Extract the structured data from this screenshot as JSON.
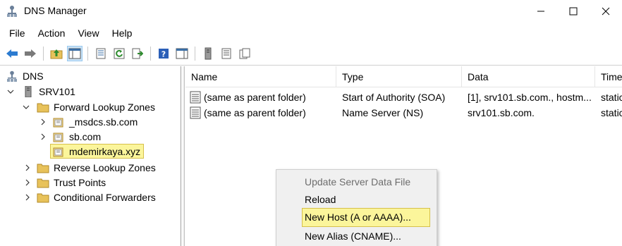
{
  "window": {
    "title": "DNS Manager",
    "icon": "dns-manager-icon"
  },
  "menu": [
    "File",
    "Action",
    "View",
    "Help"
  ],
  "toolbar": {
    "buttons": [
      "back-icon",
      "forward-icon",
      "up-folder-icon",
      "show-hide-tree-icon",
      "properties-icon",
      "refresh-icon",
      "export-list-icon",
      "help-icon",
      "action-pane-icon",
      "server-icon",
      "zone-list-icon",
      "copy-icon"
    ]
  },
  "tree": {
    "root": "DNS",
    "server": "SRV101",
    "items": [
      {
        "label": "Forward Lookup Zones"
      },
      {
        "label": "_msdcs.sb.com"
      },
      {
        "label": "sb.com"
      },
      {
        "label": "mdemirkaya.xyz",
        "selected": true
      },
      {
        "label": "Reverse Lookup Zones"
      },
      {
        "label": "Trust Points"
      },
      {
        "label": "Conditional Forwarders"
      }
    ]
  },
  "list": {
    "columns": [
      "Name",
      "Type",
      "Data",
      "Time"
    ],
    "rows": [
      {
        "name": "(same as parent folder)",
        "type": "Start of Authority (SOA)",
        "data": "[1], srv101.sb.com., hostm...",
        "time": "static"
      },
      {
        "name": "(same as parent folder)",
        "type": "Name Server (NS)",
        "data": "srv101.sb.com.",
        "time": "static"
      }
    ]
  },
  "context_menu": {
    "items": [
      {
        "label": "Update Server Data File",
        "disabled": true
      },
      {
        "label": "Reload"
      },
      {
        "label": "New Host (A or AAAA)...",
        "highlighted": true
      },
      {
        "label": "New Alias (CNAME)..."
      }
    ]
  },
  "colors": {
    "highlight": "#fbf59b",
    "highlight_border": "#d6c04b",
    "selection": "#cce4f7"
  }
}
